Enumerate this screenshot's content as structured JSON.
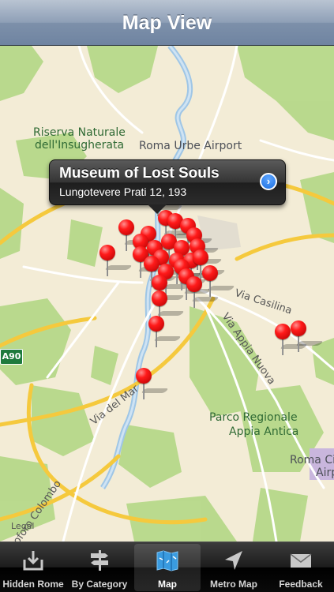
{
  "navbar": {
    "title": "Map View"
  },
  "map": {
    "labels": {
      "riserva_1": "Riserva Naturale",
      "riserva_2": "dell'Insugherata",
      "airport": "Roma Urbe Airport",
      "via_casilina": "Via Casilina",
      "via_appia": "Via Appia Nuova",
      "parco_1": "Parco Regionale",
      "parco_2": "Appia Antica",
      "roma_ci": "Roma Ci",
      "airp": "Airp",
      "via_del_mar": "Via del Mar",
      "colombo": "oforo Colombo",
      "legal": "Legal",
      "a90": "A90"
    },
    "callout": {
      "title": "Museum of Lost Souls",
      "subtitle": "Lungotevere Prati 12, 193",
      "disclosure_icon": "chevron-right-icon"
    },
    "pin_color": "#ff1a1a"
  },
  "tabbar": {
    "tabs": [
      {
        "label": "Hidden Rome",
        "icon": "download-tray-icon",
        "active": false
      },
      {
        "label": "By Category",
        "icon": "signpost-icon",
        "active": false
      },
      {
        "label": "Map",
        "icon": "map-icon",
        "active": true
      },
      {
        "label": "Metro Map",
        "icon": "location-arrow-icon",
        "active": false
      },
      {
        "label": "Feedback",
        "icon": "envelope-icon",
        "active": false
      }
    ]
  }
}
